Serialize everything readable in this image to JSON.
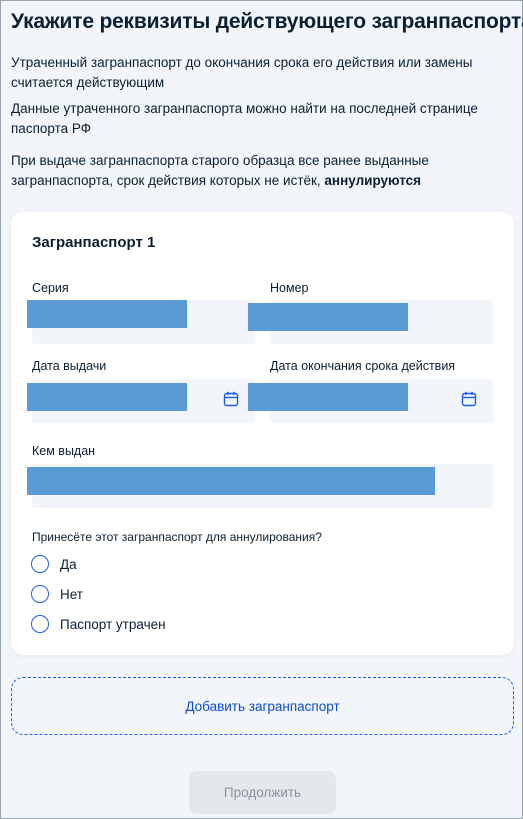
{
  "page": {
    "title": "Укажите реквизиты действующего загранпаспорта",
    "info": [
      "Утраченный загранпаспорт до окончания срока его действия или замены считается действующим",
      "Данные утраченного загранпаспорта можно найти на последней странице паспорта РФ"
    ],
    "info3_text": "При выдаче загранпаспорта старого образца все ранее выданные загранпаспорта, срок действия которых не истёк, ",
    "info3_bold": "аннулируются"
  },
  "form": {
    "card_title": "Загранпаспорт 1",
    "series_label": "Серия",
    "number_label": "Номер",
    "issue_date_label": "Дата выдачи",
    "expiry_date_label": "Дата окончания срока действия",
    "issued_by_label": "Кем выдан",
    "question": "Принесёте этот загранпаспорт для аннулирования?",
    "options": [
      "Да",
      "Нет",
      "Паспорт утрачен"
    ]
  },
  "actions": {
    "add_label": "Добавить загранпаспорт",
    "continue_label": "Продолжить"
  },
  "colors": {
    "accent": "#0d4cd3",
    "redaction": "#5b9bd5",
    "field_bg": "#f2f5f9"
  }
}
